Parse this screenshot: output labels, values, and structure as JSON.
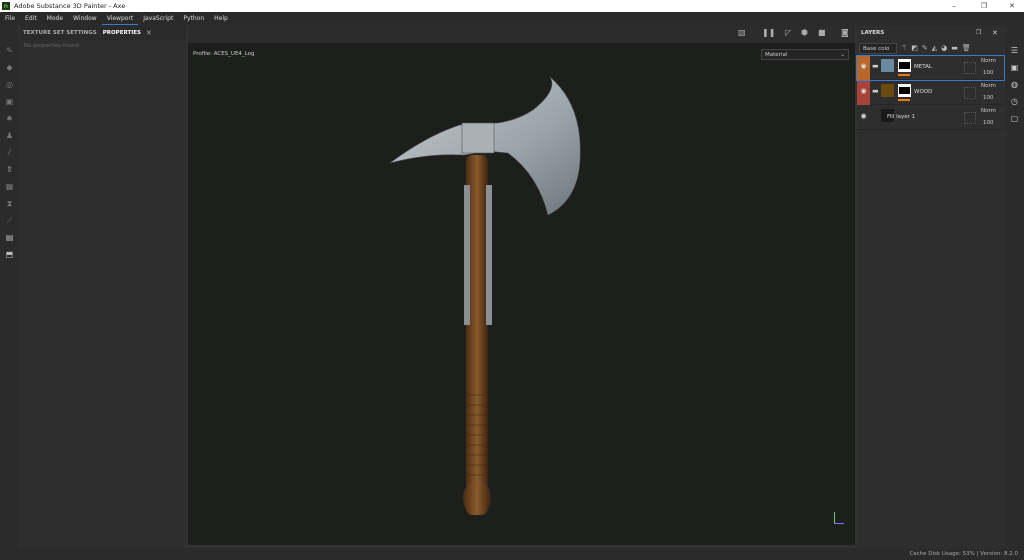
{
  "window": {
    "title": "Adobe Substance 3D Painter - Axe",
    "app_icon": "Pt"
  },
  "menu": [
    "File",
    "Edit",
    "Mode",
    "Window",
    "Viewport",
    "JavaScript",
    "Python",
    "Help"
  ],
  "active_menu": "Viewport",
  "properties": {
    "tabs": [
      "TEXTURE SET SETTINGS",
      "PROPERTIES"
    ],
    "active_tab": "PROPERTIES",
    "empty_text": "No properties found"
  },
  "viewport": {
    "profile": "Profile: ACES_UE4_Log",
    "mode_select": "Material"
  },
  "layers": {
    "title": "LAYERS",
    "channel_select": "Base colo",
    "items": [
      {
        "name": "METAL",
        "blend": "Norm",
        "opacity": "100",
        "color": "#b8672a",
        "selected": true
      },
      {
        "name": "WOOD",
        "blend": "Norm",
        "opacity": "100",
        "color": "#a8433a",
        "selected": false
      },
      {
        "name": "Fill layer 1",
        "blend": "Norm",
        "opacity": "100",
        "color": "",
        "selected": false
      }
    ]
  },
  "status": {
    "text": "Cache Disk Usage:   53% | Version: 8.2.0"
  }
}
